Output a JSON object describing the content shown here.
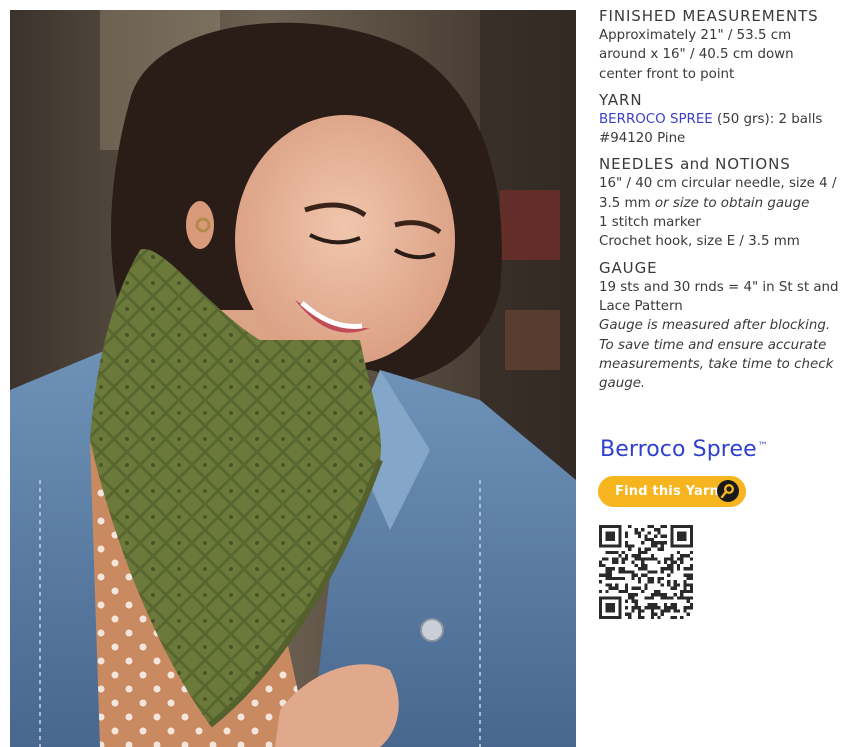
{
  "photo": {
    "alt": ""
  },
  "sections": [
    {
      "heading": "FINISHED MEASUREMENTS",
      "lines": [
        "Approximately 21\" / 53.5 cm",
        "around x 16\" / 40.5 cm down",
        "center front to point"
      ]
    },
    {
      "heading": "YARN",
      "yarn_link": "BERROCO SPREE",
      "yarn_rest": " (50 grs):  2 balls",
      "lines": [
        "#94120 Pine"
      ]
    },
    {
      "heading_part1": "NEEDLES ",
      "heading_and": "and",
      "heading_part2": " NOTIONS",
      "needle_line1": "16\" / 40 cm circular needle, size 4 /",
      "needle_line2_plain": "3.5 mm ",
      "needle_line2_italic": "or size to obtain gauge",
      "lines": [
        "1 stitch marker",
        "Crochet hook, size E / 3.5 mm"
      ]
    },
    {
      "heading": "GAUGE",
      "lines": [
        "19 sts and 30 rnds = 4\" in St st and",
        "Lace Pattern"
      ],
      "italic_lines": [
        "Gauge is measured after blocking.",
        "To save time and ensure accurate",
        "measurements, take time to check",
        "gauge."
      ]
    }
  ],
  "brand": {
    "name": "Berroco Spree",
    "tm": "™"
  },
  "find_button": {
    "label": "Find this Yarn"
  },
  "colors": {
    "link": "#3c3fc8",
    "brand": "#2f3fd0",
    "button": "#f6b51e",
    "text": "#3a3a3a"
  },
  "icons": {
    "magnifier": "magnifier-icon",
    "qr": "qr-code"
  }
}
